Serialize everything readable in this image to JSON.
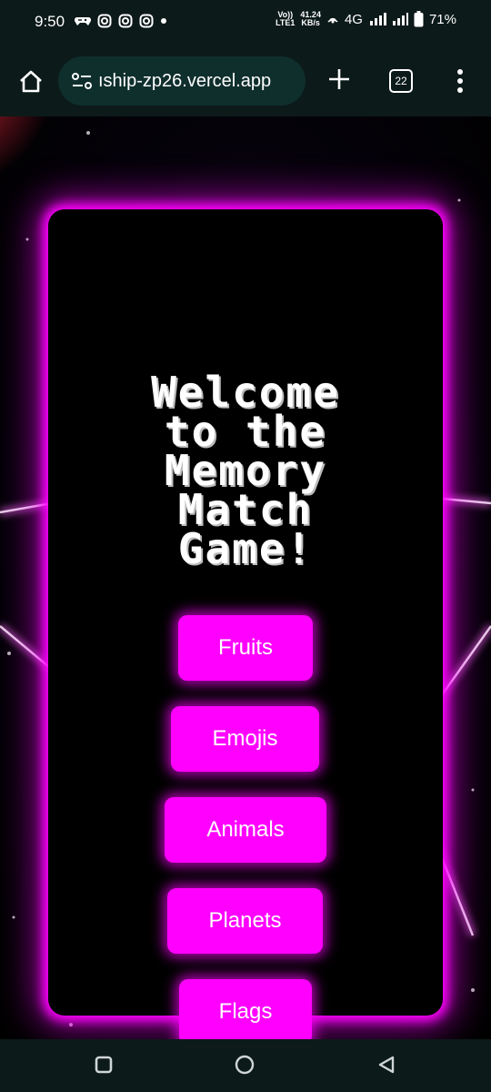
{
  "status_bar": {
    "time": "9:50",
    "volte_line1": "Vo))",
    "volte_line2": "LTE1",
    "speed_value": "41.24",
    "speed_unit": "KB/s",
    "network": "4G",
    "battery": "71%",
    "icons": [
      "game-controller-icon",
      "instagram-icon",
      "instagram-icon",
      "instagram-icon",
      "dot-icon",
      "hotspot-icon",
      "signal-icon",
      "signal-icon",
      "battery-icon"
    ]
  },
  "browser": {
    "url": "ıship-zp26.vercel.app",
    "tab_count": "22",
    "icons": [
      "home-icon",
      "site-settings-icon",
      "new-tab-plus-icon",
      "tab-switcher-icon",
      "overflow-menu-icon"
    ]
  },
  "page": {
    "title_lines": [
      "Welcome",
      "to the",
      "Memory",
      "Match",
      "Game!"
    ],
    "categories": [
      "Fruits",
      "Emojis",
      "Animals",
      "Planets",
      "Flags"
    ],
    "accent": "#ff00ff",
    "panel_color": "#000000"
  },
  "nav_bar": {
    "icons": [
      "recents-icon",
      "home-circle-icon",
      "back-icon"
    ]
  }
}
